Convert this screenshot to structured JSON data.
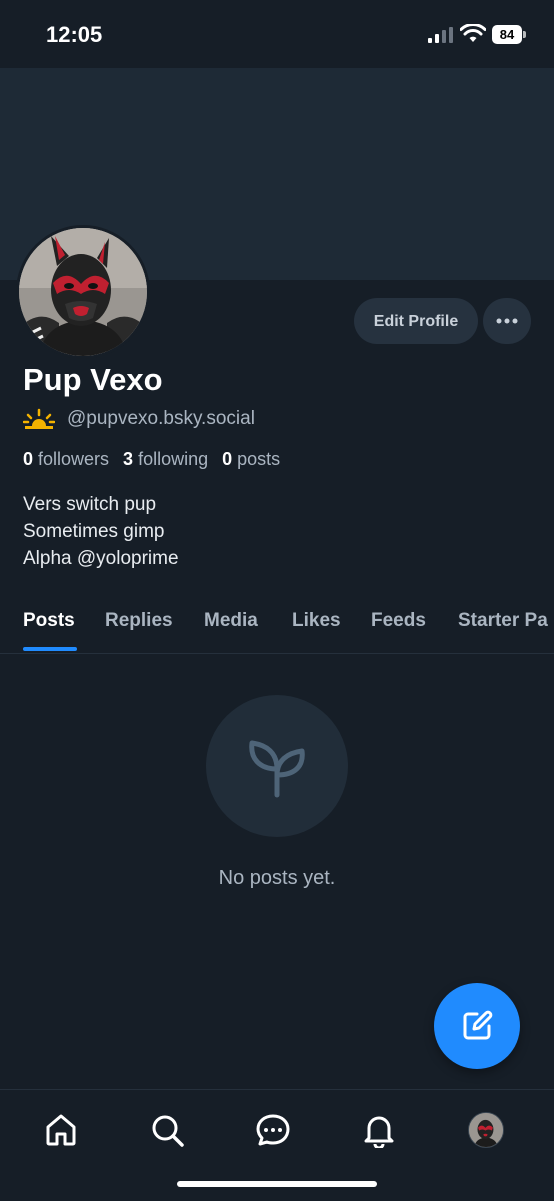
{
  "status_bar": {
    "time": "12:05",
    "battery": "84"
  },
  "profile": {
    "name": "Pup Vexo",
    "handle": "@pupvexo.bsky.social",
    "edit_label": "Edit Profile",
    "stats": {
      "followers_count": "0",
      "followers_label": "followers",
      "following_count": "3",
      "following_label": "following",
      "posts_count": "0",
      "posts_label": "posts"
    },
    "bio": [
      "Vers switch pup",
      "Sometimes gimp",
      "Alpha @yoloprime"
    ]
  },
  "tabs": [
    {
      "label": "Posts"
    },
    {
      "label": "Replies"
    },
    {
      "label": "Media"
    },
    {
      "label": "Likes"
    },
    {
      "label": "Feeds"
    },
    {
      "label": "Starter Pa"
    }
  ],
  "empty_state": {
    "text": "No posts yet.",
    "icon": "seedling-icon"
  },
  "colors": {
    "accent": "#208bfe",
    "background": "#161e27",
    "banner": "#1e2a36"
  }
}
